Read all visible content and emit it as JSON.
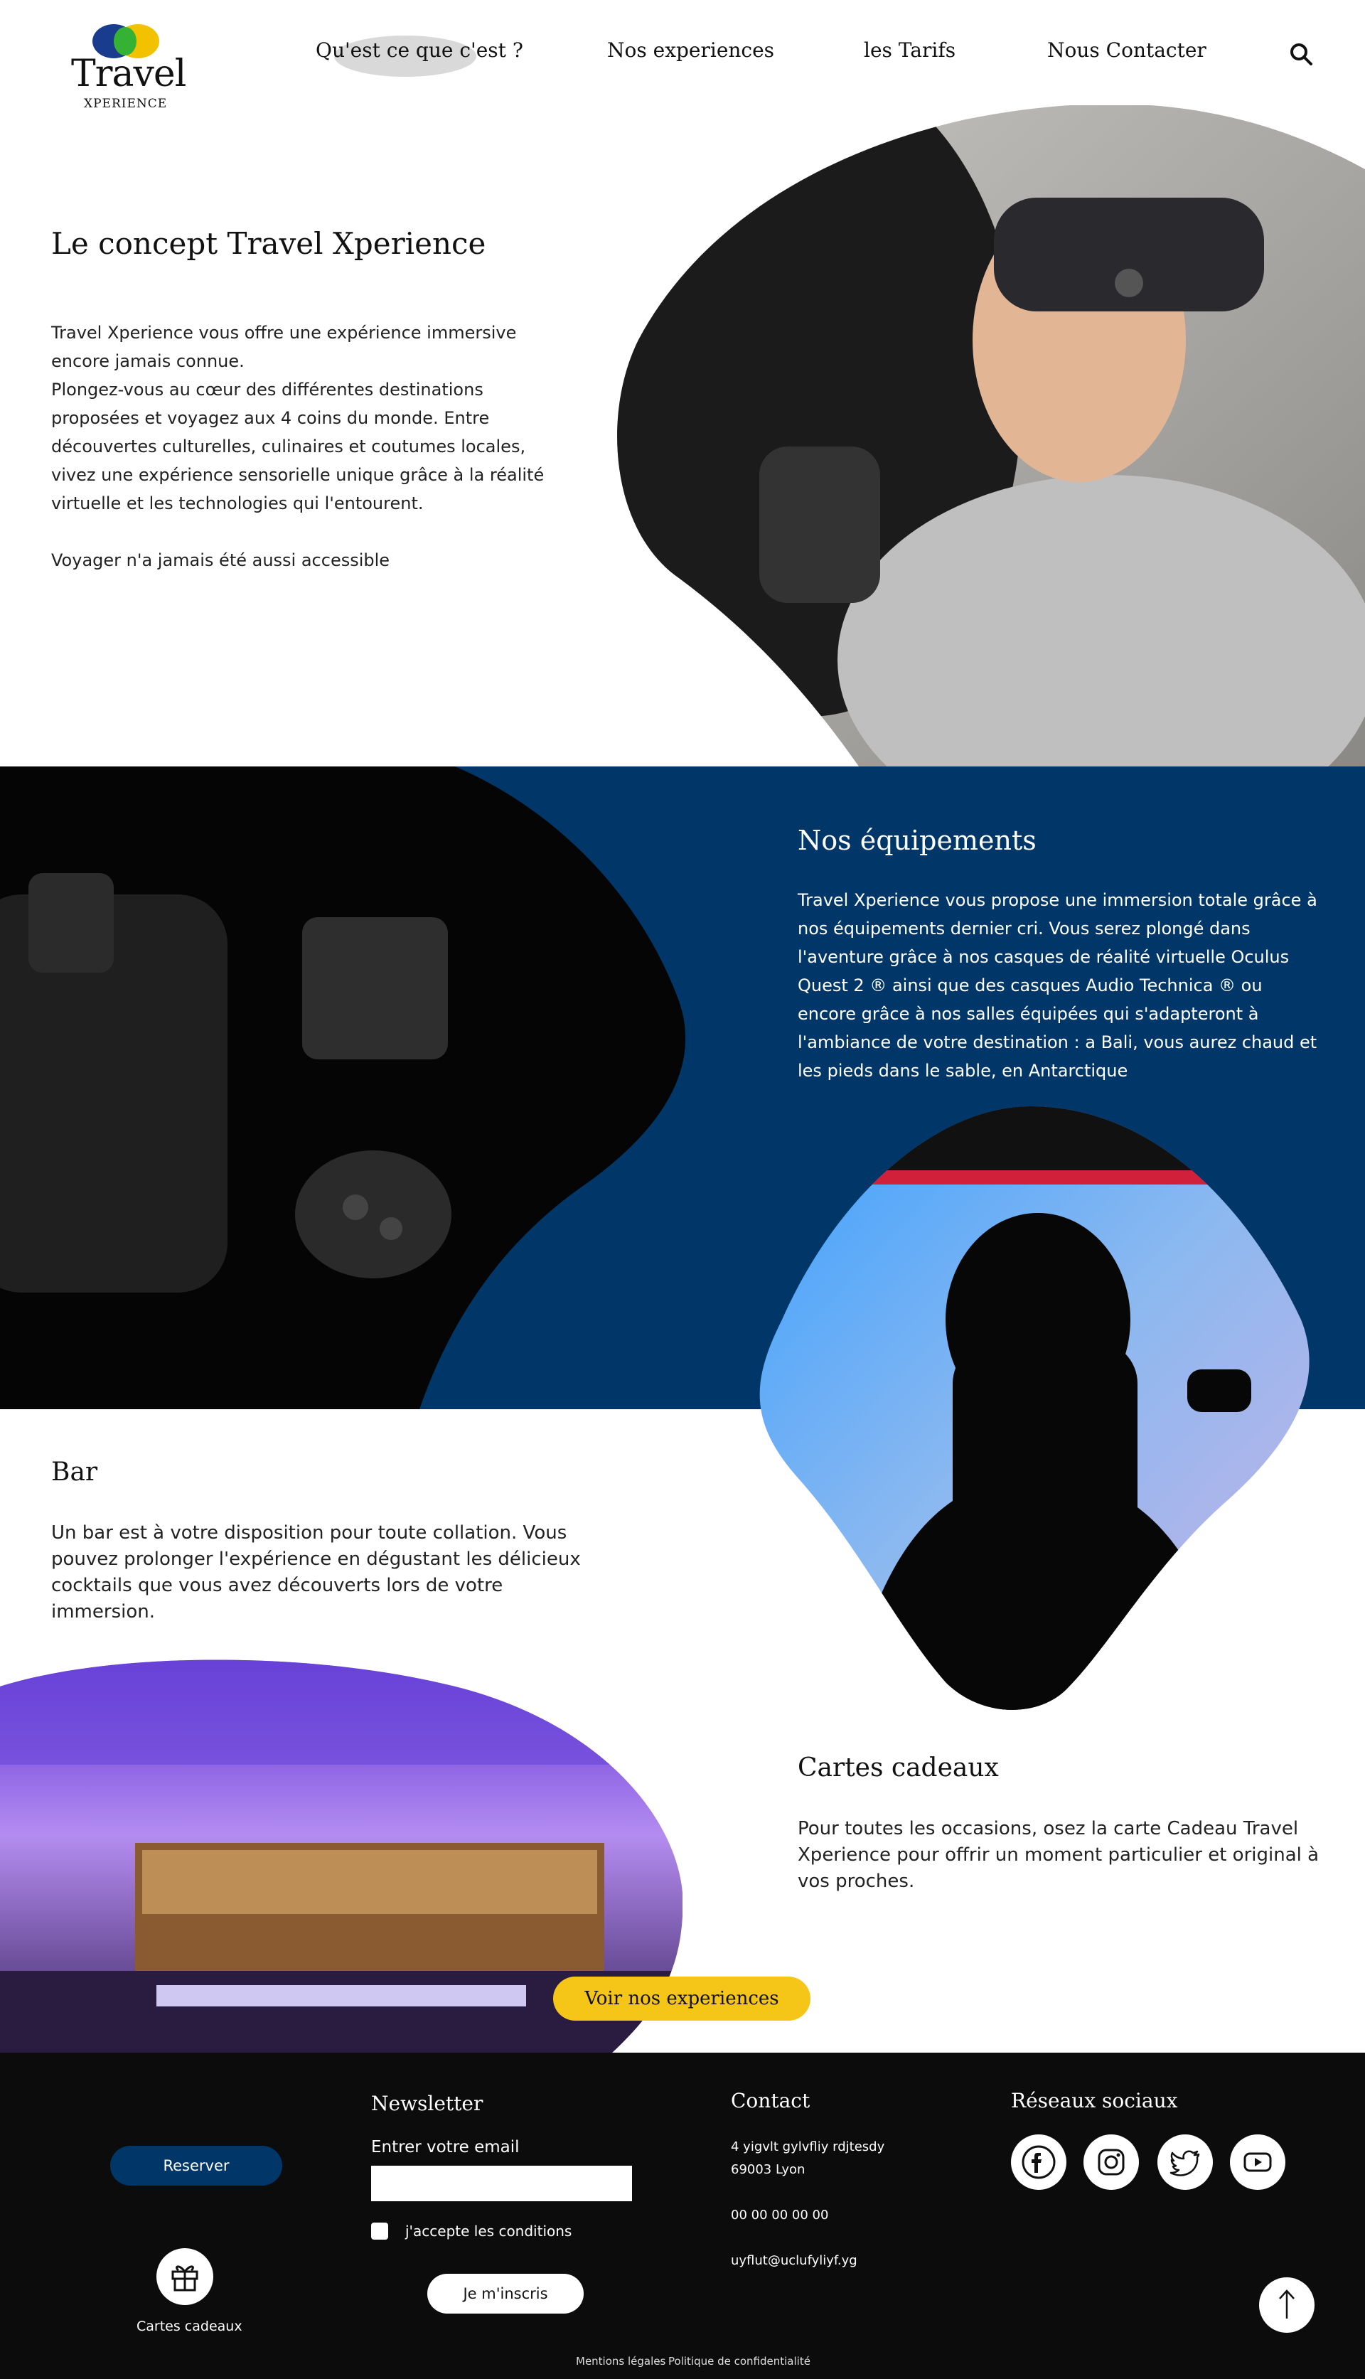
{
  "header": {
    "logo_text": "Travel",
    "logo_sub": "XPERIENCE",
    "nav": [
      "Qu'est ce que c'est ?",
      "Nos experiences",
      "les Tarifs",
      "Nous Contacter"
    ]
  },
  "concept": {
    "title": "Le concept Travel Xperience",
    "p1": "Travel Xperience vous offre une expérience immersive encore jamais connue.",
    "p2": "Plongez-vous au cœur des différentes destinations proposées et voyagez aux 4 coins du monde. Entre découvertes culturelles, culinaires et coutumes locales, vivez une expérience sensorielle unique grâce à la réalité virtuelle et les technologies qui l'entourent.",
    "p3": "Voyager n'a jamais été aussi accessible"
  },
  "equipements": {
    "title": "Nos équipements",
    "text": "Travel Xperience vous propose une immersion totale grâce à nos équipements dernier cri. Vous serez plongé dans l'aventure grâce à nos casques de réalité virtuelle Oculus Quest 2 ® ainsi que des casques Audio Technica ® ou encore grâce à nos salles équipées qui s'adapteront à l'ambiance de votre destination : a Bali, vous aurez chaud et les pieds dans le sable, en Antarctique"
  },
  "bar": {
    "title": "Bar",
    "text": "Un bar est à votre disposition pour toute collation. Vous pouvez prolonger l'expérience en dégustant les délicieux cocktails que vous avez découverts lors de votre immersion."
  },
  "cartes": {
    "title": "Cartes cadeaux",
    "text": "Pour toutes les occasions, osez la carte Cadeau Travel Xperience pour offrir un moment particulier et original à vos proches.",
    "button": "Voir nos experiences"
  },
  "footer": {
    "reserve": "Reserver",
    "gift_label": "Cartes cadeaux",
    "newsletter_title": "Newsletter",
    "email_label": "Entrer votre email",
    "email_value": "",
    "accept": "j'accepte les conditions",
    "subscribe": "Je m'inscris",
    "contact_title": "Contact",
    "address1": "4 yigvlt gylvfliy rdjtesdy",
    "address2": "69003 Lyon",
    "phone": "00 00 00 00 00",
    "email": "uyflut@uclufyliyf.yg",
    "social_title": "Réseaux sociaux",
    "social_icons": [
      "facebook-icon",
      "instagram-icon",
      "twitter-icon",
      "youtube-icon"
    ],
    "legal1": "Mentions légales",
    "sep": "-",
    "legal2": "Politique de confidentialité"
  },
  "colors": {
    "blue": "#003768",
    "yellow": "#f5c518",
    "footer": "#0c0c0c"
  }
}
